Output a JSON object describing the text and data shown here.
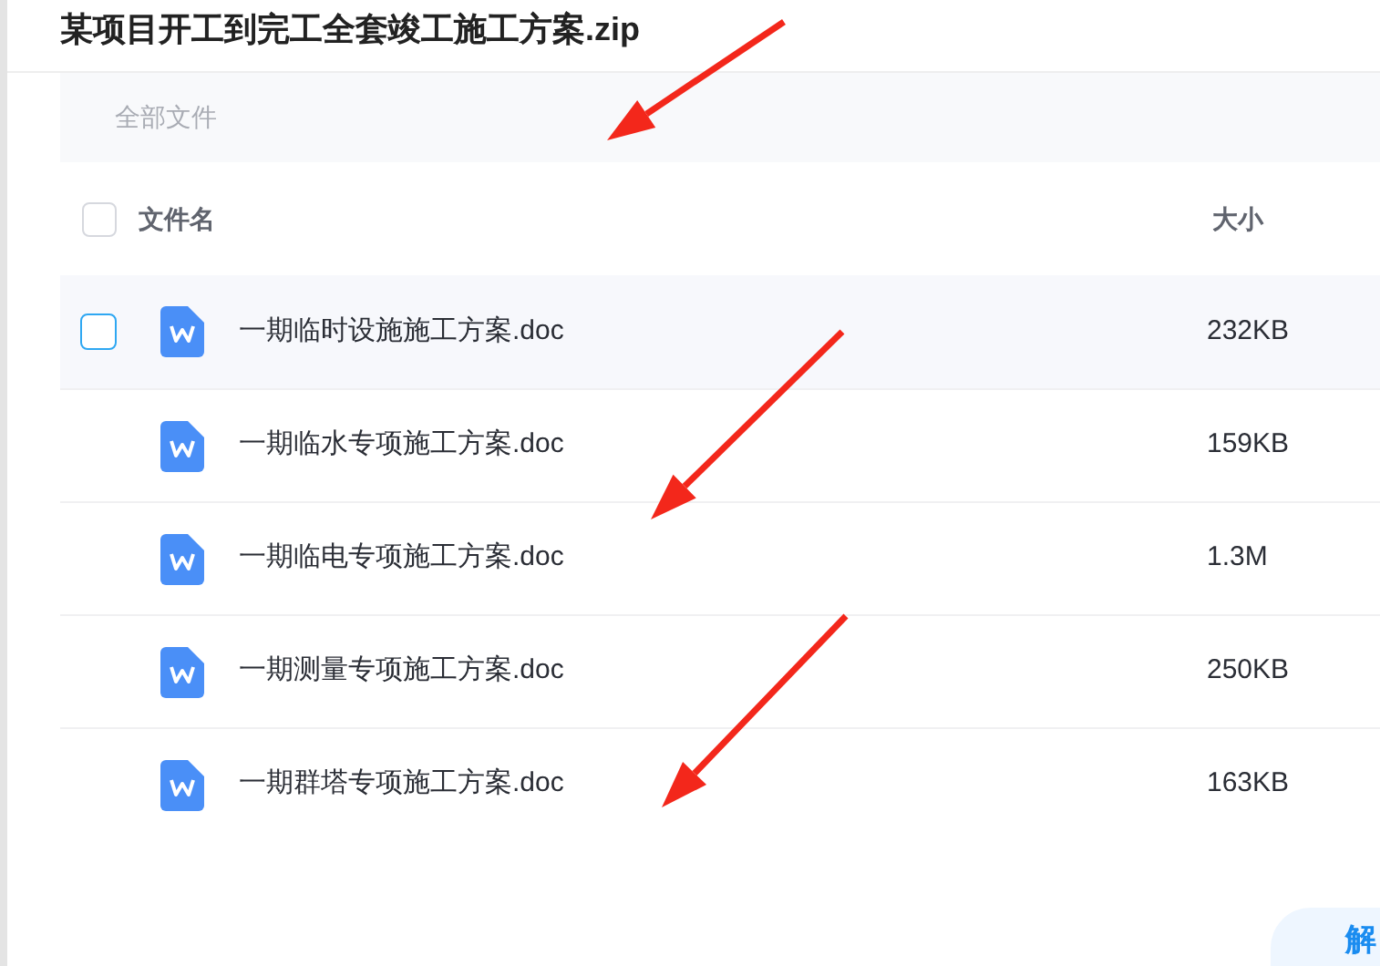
{
  "title": "某项目开工到完工全套竣工施工方案.zip",
  "breadcrumb": "全部文件",
  "columns": {
    "name": "文件名",
    "size": "大小",
    "all_checked": false
  },
  "files": [
    {
      "name": "一期临时设施施工方案.doc",
      "size": "232KB",
      "hovered": true,
      "checked": false
    },
    {
      "name": "一期临水专项施工方案.doc",
      "size": "159KB",
      "hovered": false
    },
    {
      "name": "一期临电专项施工方案.doc",
      "size": "1.3M",
      "hovered": false
    },
    {
      "name": "一期测量专项施工方案.doc",
      "size": "250KB",
      "hovered": false
    },
    {
      "name": "一期群塔专项施工方案.doc",
      "size": "163KB",
      "hovered": false
    }
  ],
  "action_button": {
    "label": "解"
  }
}
